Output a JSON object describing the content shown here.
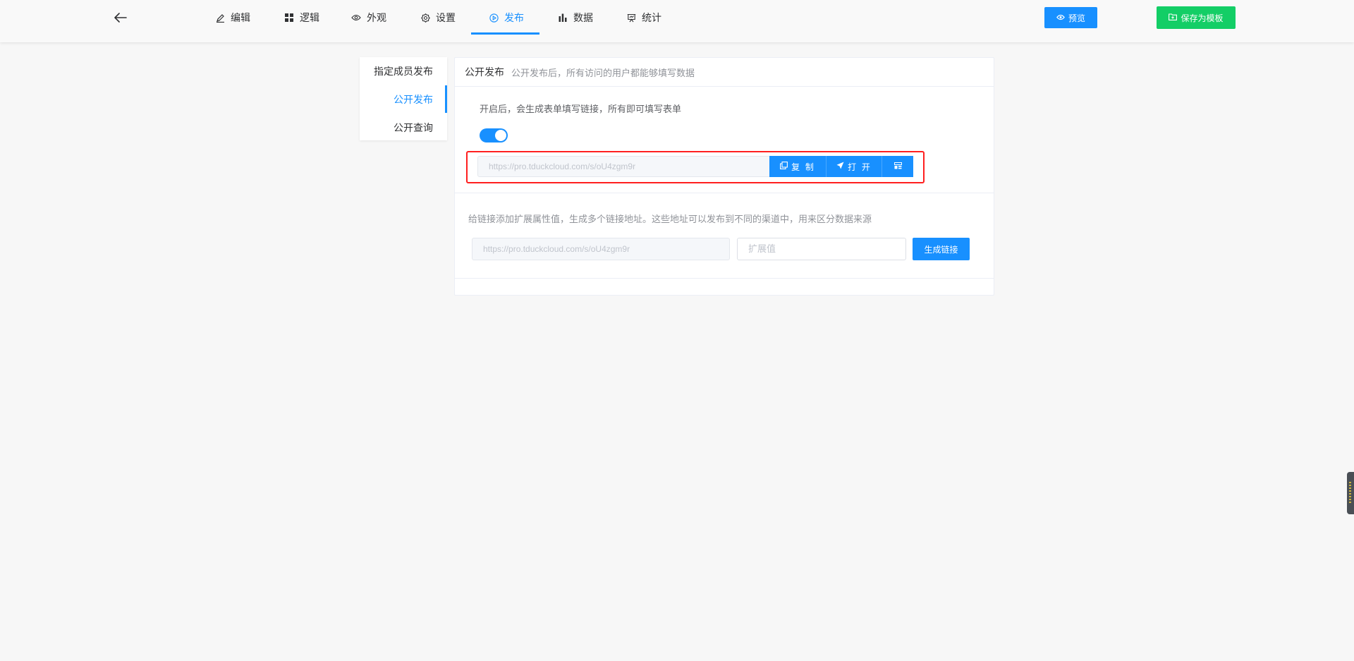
{
  "header": {
    "nav": [
      {
        "label": "编辑",
        "icon": "edit-icon"
      },
      {
        "label": "逻辑",
        "icon": "grid-icon"
      },
      {
        "label": "外观",
        "icon": "eye-icon"
      },
      {
        "label": "设置",
        "icon": "gear-icon"
      },
      {
        "label": "发布",
        "icon": "play-circle-icon",
        "active": true
      },
      {
        "label": "数据",
        "icon": "bar-chart-icon"
      },
      {
        "label": "统计",
        "icon": "presentation-icon"
      }
    ],
    "preview_label": "预览",
    "save_template_label": "保存为模板"
  },
  "submenu": {
    "items": [
      {
        "label": "指定成员发布"
      },
      {
        "label": "公开发布",
        "active": true
      },
      {
        "label": "公开查询"
      }
    ]
  },
  "panel": {
    "title": "公开发布",
    "desc": "公开发布后，所有访问的用户都能够填写数据",
    "hint": "开启后，会生成表单填写链接，所有即可填写表单",
    "switch_on": true,
    "link": "https://pro.tduckcloud.com/s/oU4zgm9r",
    "copy_label": "复 制",
    "open_label": "打 开",
    "ext_hint": "给链接添加扩展属性值，生成多个链接地址。这些地址可以发布到不同的渠道中，用来区分数据来源",
    "ext_link": "https://pro.tduckcloud.com/s/oU4zgm9r",
    "ext_placeholder": "扩展值",
    "generate_label": "生成链接"
  },
  "colors": {
    "primary": "#1890ff",
    "success": "#13ce66",
    "highlight": "#ff1f1f"
  }
}
